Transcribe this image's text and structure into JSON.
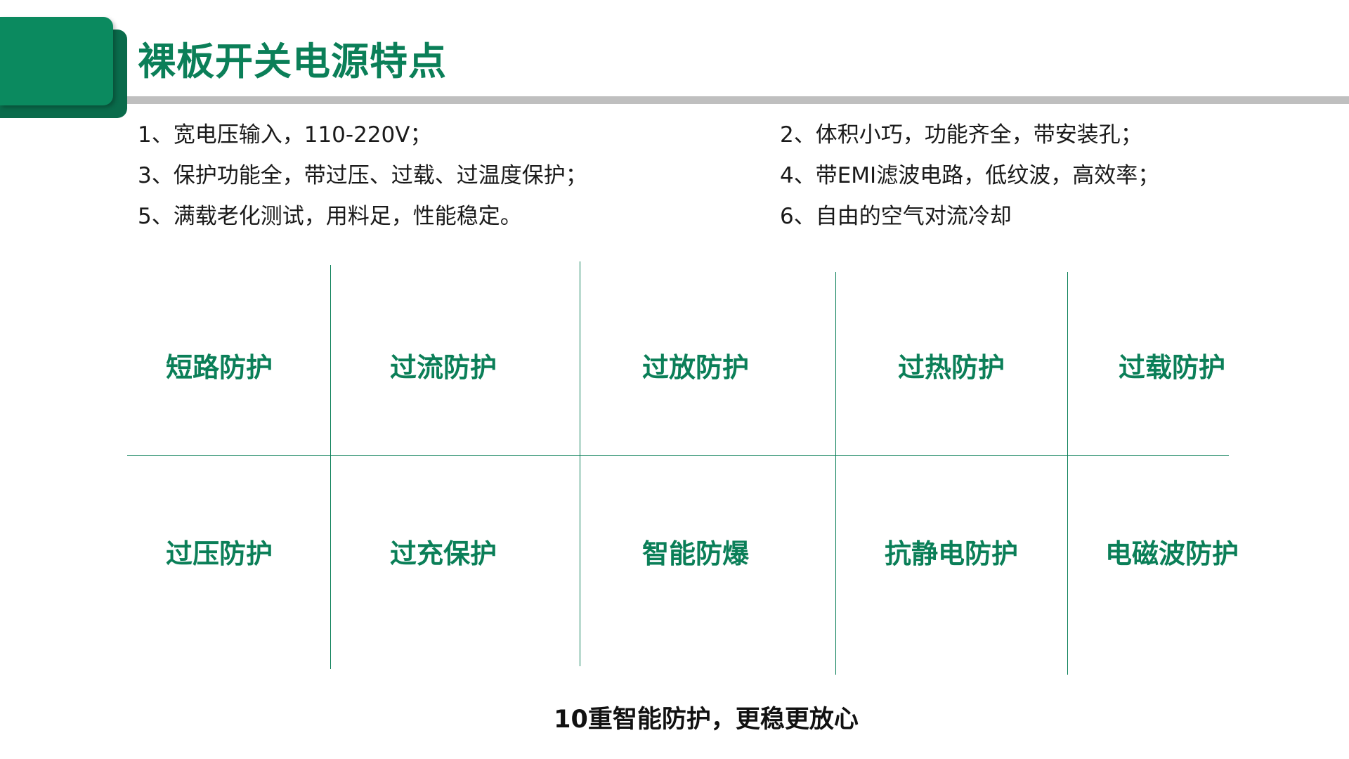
{
  "header": {
    "title": "裸板开关电源特点"
  },
  "features": [
    "1、宽电压输入，110-220V；",
    "2、体积小巧，功能齐全，带安装孔；",
    "3、保护功能全，带过压、过载、过温度保护；",
    "4、带EMI滤波电路，低纹波，高效率；",
    "5、满载老化测试，用料足，性能稳定。",
    "6、自由的空气对流冷却"
  ],
  "protections": {
    "row1": [
      "短路防护",
      "过流防护",
      "过放防护",
      "过热防护",
      "过载防护"
    ],
    "row2": [
      "过压防护",
      "过充保护",
      "智能防爆",
      "抗静电防护",
      "电磁波防护"
    ]
  },
  "tagline": "10重智能防护，更稳更放心",
  "colors": {
    "accent_green": "#0b7f58",
    "tab_green": "#0b8a5f",
    "tab_green_dark": "#0a6b4b",
    "rule_gray": "#bfbfbf",
    "text_dark": "#1a1a1a"
  }
}
